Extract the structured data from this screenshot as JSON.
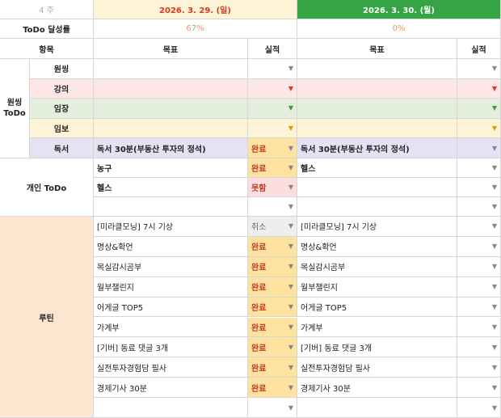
{
  "header": {
    "week": "4 주",
    "day1": "2026. 3. 29. (일)",
    "day2": "2026. 3. 30. (월)",
    "achieve_label": "ToDo 달성률",
    "day1_pct": "67%",
    "day2_pct": "0%",
    "item_label": "항목",
    "goal_label": "목표",
    "result_label": "실적"
  },
  "colors": {
    "day2_header_bg": "#34a444",
    "orange_bg": "#fde6cf",
    "red_bg": "#fde6e6",
    "green_bg": "#e3efdc",
    "yellow_bg": "#fdf3d6",
    "purple_bg": "#e6e2f4",
    "status_yellow_bg": "#fde2a0"
  },
  "sections": {
    "wonssing_todo": "원씽\nToDo",
    "personal_todo": "개인 ToDo",
    "routine": "루틴"
  },
  "wonssing_rows": [
    {
      "name": "원씽",
      "goal1": "",
      "status1": "",
      "goal2": "",
      "status2": ""
    },
    {
      "name": "강의",
      "goal1": "",
      "status1": "",
      "goal2": "",
      "status2": ""
    },
    {
      "name": "임장",
      "goal1": "",
      "status1": "",
      "goal2": "",
      "status2": ""
    },
    {
      "name": "임보",
      "goal1": "",
      "status1": "",
      "goal2": "",
      "status2": ""
    },
    {
      "name": "독서",
      "goal1": "독서 30분(부동산 투자의 정석)",
      "status1": "완료",
      "goal2": "독서 30분(부동산 투자의 정석)",
      "status2": ""
    }
  ],
  "personal_rows": [
    {
      "goal1": "농구",
      "status1": "완료",
      "goal2": "헬스",
      "status2": ""
    },
    {
      "goal1": "헬스",
      "status1": "못함",
      "goal2": "",
      "status2": ""
    },
    {
      "goal1": "",
      "status1": "",
      "goal2": "",
      "status2": ""
    }
  ],
  "routine_rows": [
    {
      "goal1": "[미라클모닝] 7시 기상",
      "status1": "취소",
      "goal2": "[미라클모닝] 7시 기상",
      "status2": ""
    },
    {
      "goal1": "명상&확언",
      "status1": "완료",
      "goal2": "명상&확언",
      "status2": ""
    },
    {
      "goal1": "목실감시곰부",
      "status1": "완료",
      "goal2": "목실감시곰부",
      "status2": ""
    },
    {
      "goal1": "월부챌린지",
      "status1": "완료",
      "goal2": "월부챌린지",
      "status2": ""
    },
    {
      "goal1": "어게글 TOP5",
      "status1": "완료",
      "goal2": "어게글 TOP5",
      "status2": ""
    },
    {
      "goal1": "가계부",
      "status1": "완료",
      "goal2": "가계부",
      "status2": ""
    },
    {
      "goal1": "[기버] 동료 댓글 3개",
      "status1": "완료",
      "goal2": "[기버] 동료 댓글 3개",
      "status2": ""
    },
    {
      "goal1": "실전투자경험담 필사",
      "status1": "완료",
      "goal2": "실전투자경험담 필사",
      "status2": ""
    },
    {
      "goal1": "경제기사 30분",
      "status1": "완료",
      "goal2": "경제기사 30분",
      "status2": ""
    },
    {
      "goal1": "",
      "status1": "",
      "goal2": "",
      "status2": ""
    }
  ]
}
